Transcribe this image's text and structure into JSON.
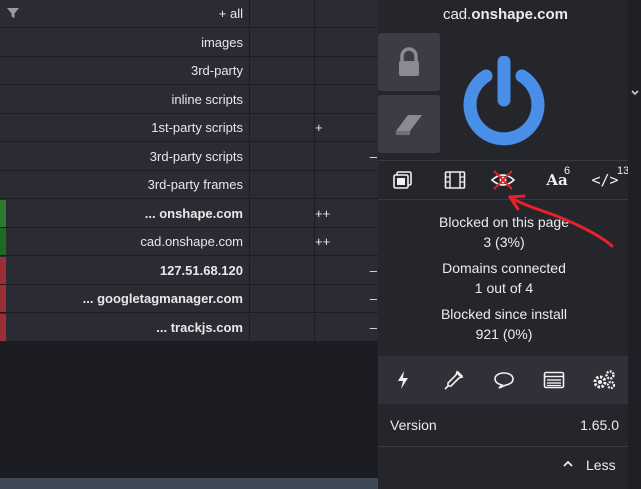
{
  "filters": {
    "rows": [
      {
        "host": "+ all",
        "bold": false,
        "col3": "",
        "col3_side": "",
        "color": ""
      },
      {
        "host": "images",
        "bold": false,
        "col3": "",
        "col3_side": "",
        "color": ""
      },
      {
        "host": "3rd-party",
        "bold": false,
        "col3": "",
        "col3_side": "",
        "color": ""
      },
      {
        "host": "inline scripts",
        "bold": false,
        "col3": "",
        "col3_side": "",
        "color": ""
      },
      {
        "host": "1st-party scripts",
        "bold": false,
        "col3": "+",
        "col3_side": "left",
        "color": ""
      },
      {
        "host": "3rd-party scripts",
        "bold": false,
        "col3": "–",
        "col3_side": "right",
        "color": ""
      },
      {
        "host": "3rd-party frames",
        "bold": false,
        "col3": "",
        "col3_side": "",
        "color": ""
      },
      {
        "host": "... onshape.com",
        "bold": true,
        "col3": "++",
        "col3_side": "left",
        "color": "#2c7a2e"
      },
      {
        "host": "cad.onshape.com",
        "bold": false,
        "col3": "++",
        "col3_side": "left",
        "color": "#1e6a22"
      },
      {
        "host": "127.51.68.120",
        "bold": true,
        "col3": "–",
        "col3_side": "right",
        "color": "#9c2f35"
      },
      {
        "host": "... googletagmanager.com",
        "bold": true,
        "col3": "–",
        "col3_side": "right",
        "color": "#9c2f35"
      },
      {
        "host": "... trackjs.com",
        "bold": true,
        "col3": "–",
        "col3_side": "right",
        "color": "#9c2f35"
      }
    ]
  },
  "popup": {
    "title_prefix": "cad.",
    "title_domain": "onshape.com",
    "tools": {
      "fonts_sup": "6",
      "scripts_sup": "13",
      "fonts_label": "Aa",
      "scripts_label": "</>"
    },
    "stats": {
      "blocked_page_label": "Blocked on this page",
      "blocked_page_value": "3 (3%)",
      "domains_label": "Domains connected",
      "domains_value": "1 out of 4",
      "blocked_install_label": "Blocked since install",
      "blocked_install_value": "921 (0%)"
    },
    "version_label": "Version",
    "version_value": "1.65.0",
    "less_label": "Less"
  },
  "colors": {
    "power_blue": "#4a8fe7",
    "annotation_red": "#e8202a",
    "allow_green": "#2c7a2e",
    "block_red": "#9c2f35"
  },
  "icons": [
    "filter-icon",
    "lock-icon",
    "eraser-icon",
    "power-icon",
    "popup-block-icon",
    "media-icon",
    "cosmetic-filter-icon",
    "fonts-icon",
    "scripts-icon",
    "lightning-icon",
    "picker-icon",
    "comment-icon",
    "logger-icon",
    "settings-icon",
    "chevron-up-icon"
  ]
}
